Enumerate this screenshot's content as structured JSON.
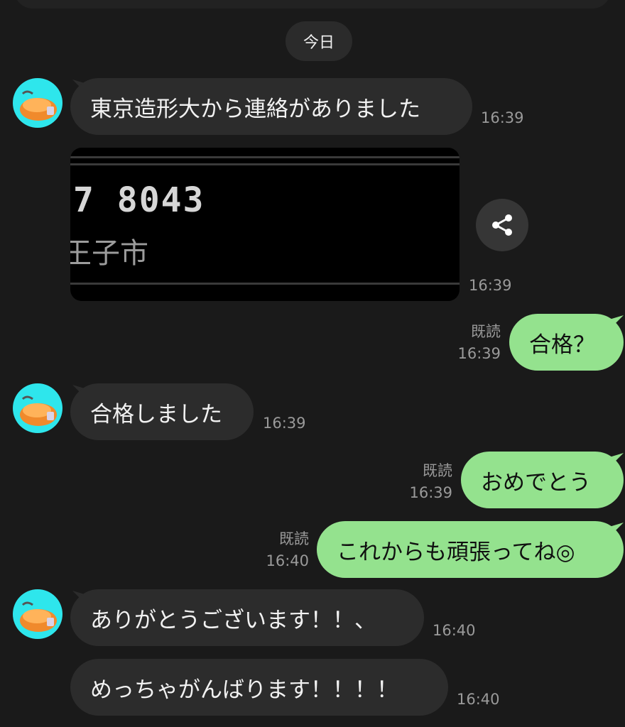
{
  "date_label": "今日",
  "messages": [
    {
      "text": "東京造形大から連絡がありました",
      "time": "16:39"
    },
    {
      "image_number": "7 8043",
      "image_city": "王子市",
      "time": "16:39"
    },
    {
      "text": "合格？",
      "read": "既読",
      "time": "16:39"
    },
    {
      "text": "合格しました",
      "time": "16:39"
    },
    {
      "text": "おめでとう",
      "read": "既読",
      "time": "16:39"
    },
    {
      "text": "これからも頑張ってね◎",
      "read": "既読",
      "time": "16:40"
    },
    {
      "text": "ありがとうございます！！、",
      "time": "16:40"
    },
    {
      "text": "めっちゃがんばります！！！！",
      "time": "16:40"
    }
  ],
  "icons": {
    "share": "share-icon",
    "avatar": "avatar-illustration"
  },
  "colors": {
    "background": "#1a1a1a",
    "incoming_bubble": "#2c2c2c",
    "outgoing_bubble": "#94e28e",
    "avatar_bg": "#2ee6ec",
    "meta_text": "#9a9a9a"
  }
}
